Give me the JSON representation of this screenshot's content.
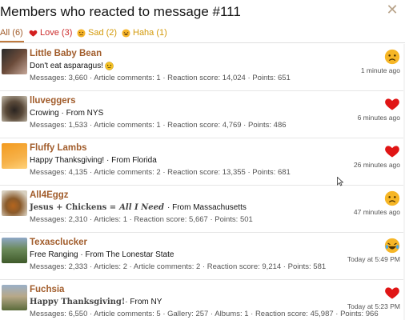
{
  "dialog": {
    "title": "Members who reacted to message #111",
    "close_icon": "close-icon"
  },
  "tabs": [
    {
      "label": "All (6)",
      "icon": "none",
      "color": "#a15c2b"
    },
    {
      "label": "Love (3)",
      "icon": "heart-icon",
      "color": "#cc2b2b"
    },
    {
      "label": "Sad (2)",
      "icon": "sad-face-icon",
      "color": "#d39a0a"
    },
    {
      "label": "Haha (1)",
      "icon": "laughing-face-icon",
      "color": "#d39a0a"
    }
  ],
  "members": [
    {
      "name": "Little Baby Bean",
      "subtitle": "Don't eat asparagus!",
      "subtitle_suffix_icon": "slight-smile-icon",
      "stats": "Messages: 3,660 · Article comments: 1 · Reaction score: 14,024 · Points: 651",
      "reaction": "sad-face-icon",
      "time": "1 minute ago"
    },
    {
      "name": "lluveggers",
      "subtitle": "Crowing · From NYS",
      "stats": "Messages: 1,533 · Article comments: 1 · Reaction score: 4,769 · Points: 486",
      "reaction": "heart-icon",
      "time": "6 minutes ago"
    },
    {
      "name": "Fluffy Lambs",
      "subtitle": "Happy Thanksgiving! · From Florida",
      "stats": "Messages: 4,135 · Article comments: 2 · Reaction score: 13,355 · Points: 681",
      "reaction": "heart-icon",
      "time": "26 minutes ago"
    },
    {
      "name": "All4Eggz",
      "subtitle_prefix": "Jesus + Chickens = ",
      "subtitle_prefix_emph": "All I Need",
      "subtitle": " · From Massachusetts",
      "stats": "Messages: 2,310 · Articles: 1 · Reaction score: 5,667 · Points: 501",
      "reaction": "sad-face-icon",
      "time": "47 minutes ago"
    },
    {
      "name": "Texasclucker",
      "subtitle": "Free Ranging · From The Lonestar State",
      "stats": "Messages: 2,333 · Articles: 2 · Article comments: 2 · Reaction score: 9,214 · Points: 581",
      "reaction": "laughing-face-icon",
      "time": "Today at 5:49 PM"
    },
    {
      "name": "Fuchsia",
      "subtitle_prefix": "Happy Thanksgiving!",
      "subtitle": " · From NY",
      "stats": "Messages: 6,550 · Article comments: 5 · Gallery: 257 · Albums: 1 · Reaction score: 45,987 · Points: 966",
      "reaction": "heart-icon",
      "time": "Today at 5:23 PM"
    }
  ],
  "colors": {
    "accent": "#a15c2b",
    "love": "#cc2b2b",
    "sad": "#f4b400",
    "tab_underline": "#c07a3e"
  }
}
